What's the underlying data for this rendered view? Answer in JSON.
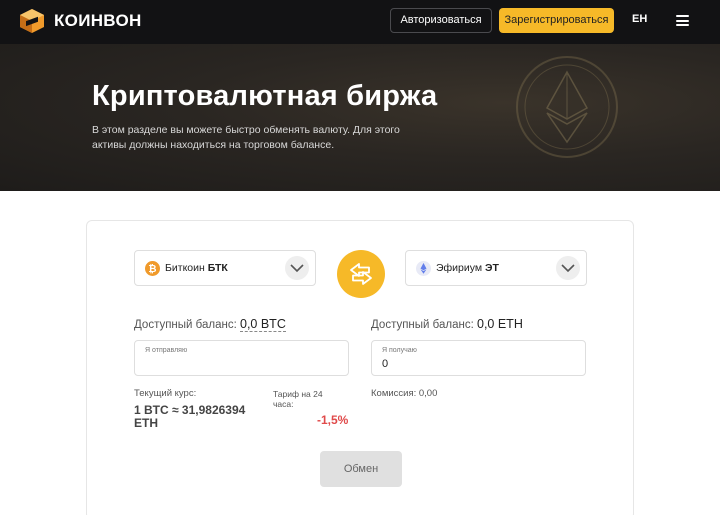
{
  "header": {
    "brand": "КОИНВОН",
    "login_label": "Авторизоваться",
    "register_label": "Зарегистрироваться",
    "language": "ЕН",
    "logo_icon": "coinbase-box-logo",
    "menu_icon": "hamburger-menu-icon"
  },
  "hero": {
    "title": "Криптовалютная биржа",
    "description": "В этом разделе вы можете быстро обменять валюту. Для этого активы должны находиться на торговом балансе.",
    "decor_icon": "ethereum-coin-icon"
  },
  "exchange": {
    "from": {
      "name": "Биткоин",
      "ticker": "БТК",
      "icon": "bitcoin-icon",
      "balance_label": "Доступный баланс:",
      "balance_value": "0,0 BTC",
      "field_label": "Я отправляю",
      "field_value": ""
    },
    "to": {
      "name": "Эфириум",
      "ticker": "ЭТ",
      "icon": "ethereum-icon",
      "balance_label": "Доступный баланс:",
      "balance_value": "0,0 ETH",
      "field_label": "Я получаю",
      "field_value": "0"
    },
    "swap_icon": "swap-arrows-icon",
    "rate_label": "Текущий курс:",
    "rate_value": "1 BTC ≈ 31,9826394 ETH",
    "tariff_label": "Тариф на 24 часа:",
    "tariff_value": "-1,5%",
    "commission": "Комиссия: 0,00",
    "submit_label": "Обмен"
  },
  "colors": {
    "accent": "#f6b928",
    "header_bg": "#121214",
    "negative": "#e04a4a"
  }
}
